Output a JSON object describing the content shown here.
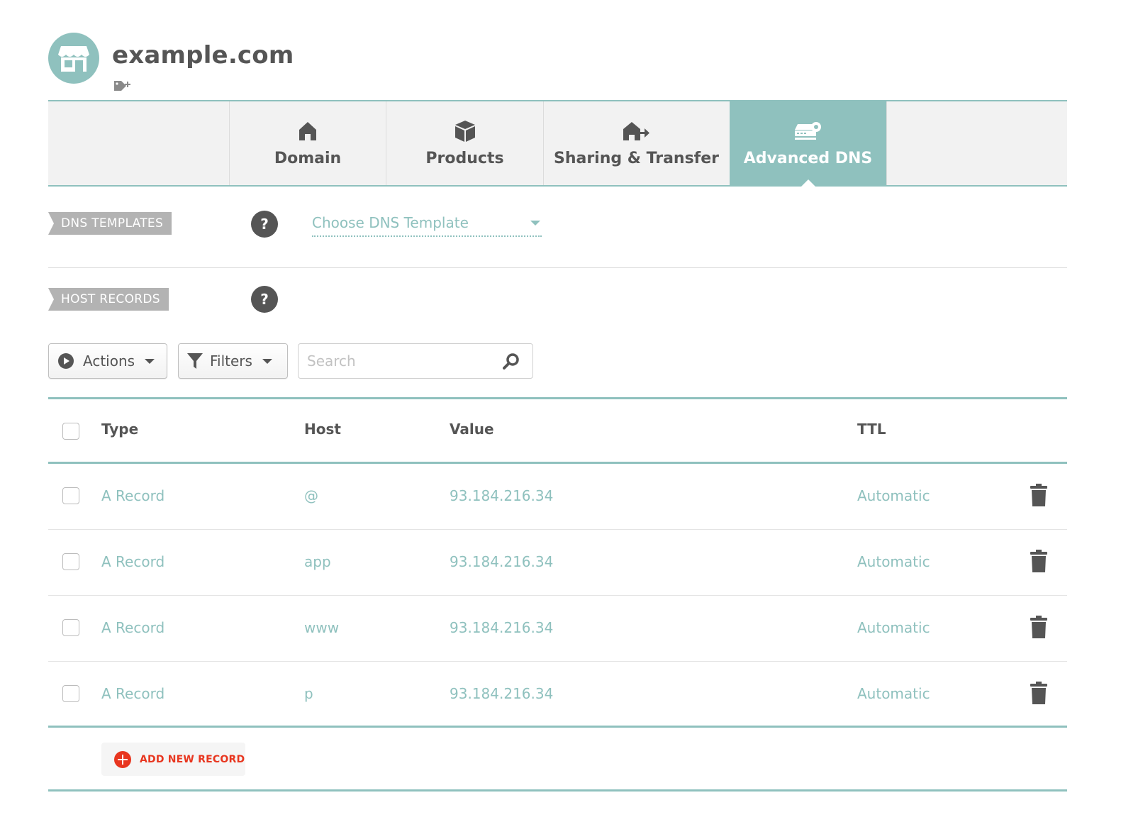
{
  "header": {
    "domain_name": "example.com",
    "avatar_icon": "storefront-icon",
    "tag_icon": "add-tag-icon"
  },
  "tabs": [
    {
      "label": "Domain",
      "icon": "home-icon",
      "active": false
    },
    {
      "label": "Products",
      "icon": "box-icon",
      "active": false
    },
    {
      "label": "Sharing & Transfer",
      "icon": "house-transfer-icon",
      "active": false
    },
    {
      "label": "Advanced DNS",
      "icon": "dns-server-icon",
      "active": true
    }
  ],
  "dns_templates": {
    "label": "DNS TEMPLATES",
    "help": "?",
    "select_placeholder": "Choose DNS Template"
  },
  "host_records": {
    "label": "HOST RECORDS",
    "help": "?"
  },
  "toolbar": {
    "actions_label": "Actions",
    "filters_label": "Filters",
    "search_placeholder": "Search"
  },
  "table": {
    "columns": {
      "type": "Type",
      "host": "Host",
      "value": "Value",
      "ttl": "TTL"
    },
    "rows": [
      {
        "type": "A Record",
        "host": "@",
        "value": "93.184.216.34",
        "ttl": "Automatic"
      },
      {
        "type": "A Record",
        "host": "app",
        "value": "93.184.216.34",
        "ttl": "Automatic"
      },
      {
        "type": "A Record",
        "host": "www",
        "value": "93.184.216.34",
        "ttl": "Automatic"
      },
      {
        "type": "A Record",
        "host": "p",
        "value": "93.184.216.34",
        "ttl": "Automatic"
      }
    ]
  },
  "add_record_label": "ADD NEW RECORD",
  "colors": {
    "accent": "#8fc1be",
    "danger": "#e8361f",
    "text": "#555555",
    "label_bg": "#b3b3b3"
  }
}
